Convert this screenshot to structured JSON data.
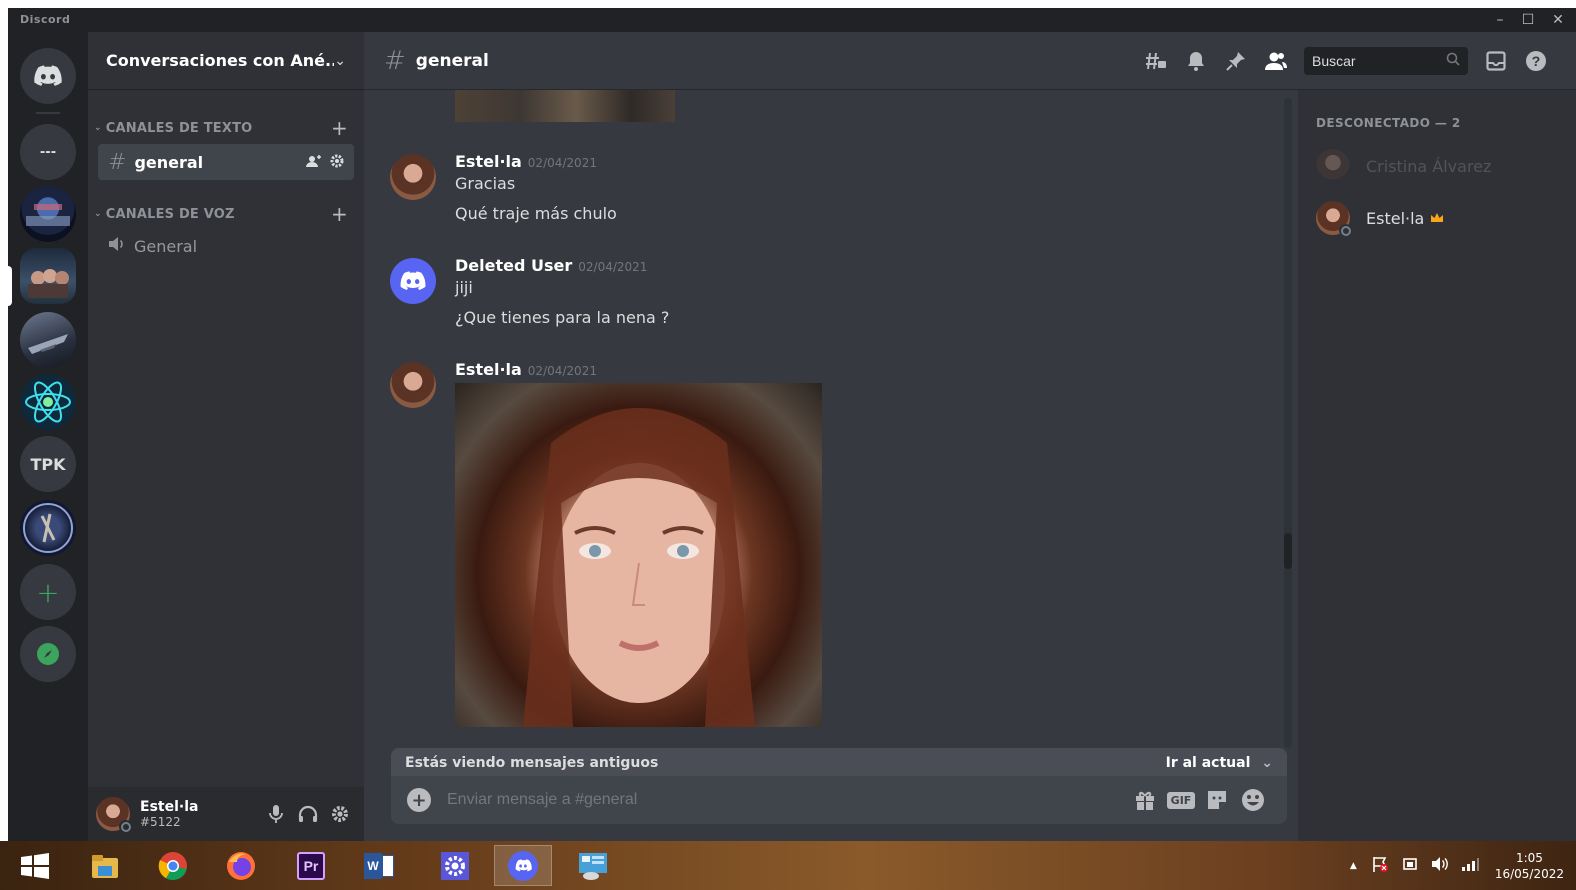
{
  "window": {
    "brand": "Discord",
    "min_glyph": "–",
    "max_glyph": "☐",
    "close_glyph": "✕"
  },
  "servers": {
    "items": [
      {
        "name": "home",
        "icon": "discord-logo-icon"
      },
      {
        "name": "dm-overflow",
        "label": "---"
      },
      {
        "name": "server-1"
      },
      {
        "name": "server-2",
        "selected": true
      },
      {
        "name": "server-3"
      },
      {
        "name": "server-atom"
      },
      {
        "name": "server-tpk",
        "label": "TPK"
      },
      {
        "name": "server-7"
      },
      {
        "name": "add-server",
        "label": "+"
      },
      {
        "name": "explore",
        "icon": "compass-icon"
      }
    ]
  },
  "guild": {
    "name": "Conversaciones con Ané...",
    "chevron": "⌄"
  },
  "categories": {
    "text": {
      "label": "CANALES DE TEXTO",
      "arrow": "⌄",
      "add": "+"
    },
    "voice": {
      "label": "CANALES DE VOZ",
      "arrow": "⌄",
      "add": "+"
    }
  },
  "channels": {
    "text_channel": {
      "hash": "#",
      "name": "general"
    },
    "voice_channel": {
      "name": "General"
    }
  },
  "user": {
    "name": "Estel·la",
    "tag": "#5122"
  },
  "chat": {
    "hash": "#",
    "title": "general",
    "search_placeholder": "Buscar"
  },
  "messages": [
    {
      "author": "Estel·la",
      "timestamp": "02/04/2021",
      "lines": [
        "Gracias",
        "Qué traje más chulo"
      ]
    },
    {
      "author": "Deleted User",
      "timestamp": "02/04/2021",
      "lines": [
        "jiji",
        "¿Que tienes para la nena ?"
      ]
    },
    {
      "author": "Estel·la",
      "timestamp": "02/04/2021",
      "lines": []
    }
  ],
  "old_messages_bar": {
    "label": "Estás viendo mensajes antiguos",
    "jump": "Ir al actual",
    "jump_chevron": "⌄"
  },
  "composer": {
    "add": "+",
    "placeholder": "Enviar mensaje a #general",
    "gif": "GIF"
  },
  "members": {
    "header": "DESCONECTADO — 2",
    "list": [
      {
        "name": "Cristina Álvarez",
        "status": "offline"
      },
      {
        "name": "Estel·la",
        "owner": true
      }
    ]
  },
  "taskbar": {
    "apps": [
      "start-button",
      "file-explorer",
      "chrome",
      "firefox",
      "premiere-pro",
      "word",
      "settings",
      "discord",
      "control-panel"
    ],
    "active_app": "discord",
    "premiere_label": "Pr",
    "word_label": "W",
    "time": "1:05",
    "date": "16/05/2022",
    "tray_arrow": "▲"
  },
  "colors": {
    "background": "#36393f",
    "sidebar": "#2f3136",
    "rail": "#202225",
    "blurple": "#5865f2",
    "green": "#3ba55d",
    "crown": "#faa61a"
  }
}
